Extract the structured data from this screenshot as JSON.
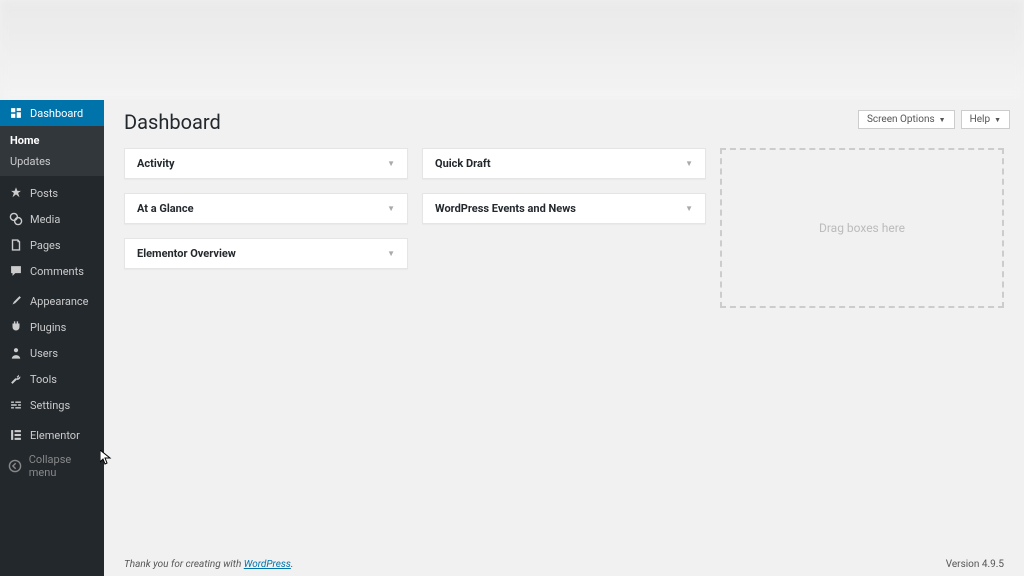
{
  "page": {
    "title": "Dashboard"
  },
  "topButtons": {
    "screenOptions": "Screen Options",
    "help": "Help"
  },
  "sidebar": {
    "dashboard": "Dashboard",
    "sub": {
      "home": "Home",
      "updates": "Updates"
    },
    "posts": "Posts",
    "media": "Media",
    "pages": "Pages",
    "comments": "Comments",
    "appearance": "Appearance",
    "plugins": "Plugins",
    "users": "Users",
    "tools": "Tools",
    "settings": "Settings",
    "elementor": "Elementor",
    "collapse": "Collapse menu"
  },
  "widgets": {
    "col1": [
      {
        "title": "Activity"
      },
      {
        "title": "At a Glance"
      },
      {
        "title": "Elementor Overview"
      }
    ],
    "col2": [
      {
        "title": "Quick Draft"
      },
      {
        "title": "WordPress Events and News"
      }
    ],
    "dropZone": "Drag boxes here"
  },
  "footer": {
    "thankYouPrefix": "Thank you for creating with ",
    "wordpressLink": "WordPress",
    "version": "Version 4.9.5"
  }
}
